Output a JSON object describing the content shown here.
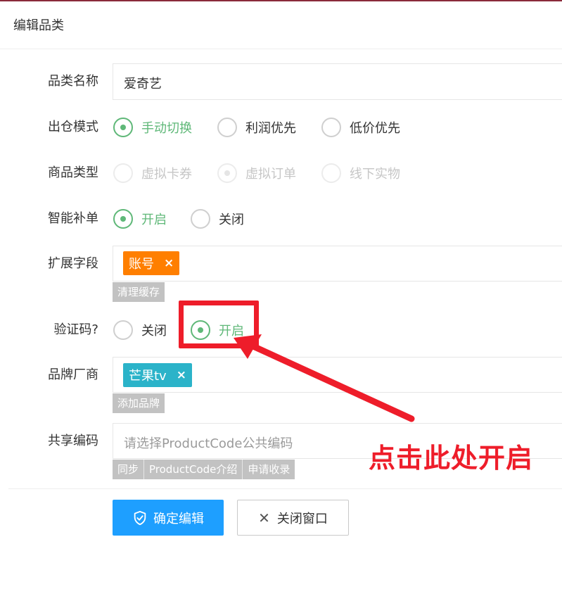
{
  "dialog": {
    "title": "编辑品类"
  },
  "form": {
    "name": {
      "label": "品类名称",
      "value": "爱奇艺"
    },
    "warehouse_mode": {
      "label": "出仓模式",
      "options": [
        "手动切换",
        "利润优先",
        "低价优先"
      ],
      "selected": "手动切换"
    },
    "product_type": {
      "label": "商品类型",
      "options": [
        "虚拟卡券",
        "虚拟订单",
        "线下实物"
      ],
      "selected": "虚拟订单",
      "disabled": true
    },
    "smart_reorder": {
      "label": "智能补单",
      "options": [
        "开启",
        "关闭"
      ],
      "selected": "开启"
    },
    "extension_fields": {
      "label": "扩展字段",
      "tags": [
        "账号"
      ],
      "tag_remove": "×",
      "action": "清理缓存"
    },
    "captcha": {
      "label": "验证码?",
      "options": [
        "关闭",
        "开启"
      ],
      "selected": "开启"
    },
    "brand": {
      "label": "品牌厂商",
      "tags": [
        "芒果tv"
      ],
      "tag_remove": "×",
      "action": "添加品牌"
    },
    "share_code": {
      "label": "共享编码",
      "placeholder": "请选择ProductCode公共编码",
      "actions": [
        "同步",
        "ProductCode介绍",
        "申请收录"
      ]
    }
  },
  "footer": {
    "confirm_label": "确定编辑",
    "close_label": "关闭窗口"
  },
  "annotation": {
    "text": "点击此处开启"
  },
  "colors": {
    "accent_green": "#5fb878",
    "primary_blue": "#1e9fff",
    "tag_orange": "#ff7f00",
    "tag_teal": "#2bb3c9",
    "annotation_red": "#ee1d2a"
  },
  "icons": {
    "confirm": "shield-check-icon",
    "close": "close-icon",
    "tag_remove": "close-icon"
  }
}
